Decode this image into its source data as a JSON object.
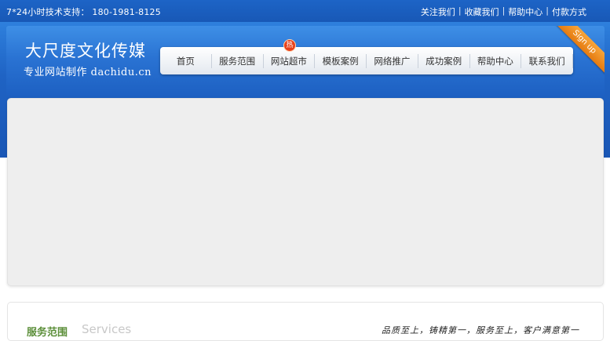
{
  "topbar": {
    "hotline": "7*24小时技术支持： 180-1981-8125",
    "links": [
      "关注我们",
      "收藏我们",
      "帮助中心",
      "付款方式"
    ],
    "separator": "|"
  },
  "header": {
    "logo_main": "大尺度文化传媒",
    "logo_sub": "专业网站制作 dachidu.cn",
    "ribbon": "Sign up",
    "hot_badge": "热"
  },
  "nav": {
    "items": [
      "首页",
      "服务范围",
      "网站超市",
      "模板案例",
      "网络推广",
      "成功案例",
      "帮助中心",
      "联系我们"
    ]
  },
  "services": {
    "title": "服务范围",
    "title_en": "Services",
    "slogan": "品质至上，铸精第一，服务至上，客户满意第一"
  },
  "colors": {
    "brand_blue": "#1d64c6",
    "badge_red": "#e8411a",
    "ribbon_orange": "#e57a10"
  }
}
